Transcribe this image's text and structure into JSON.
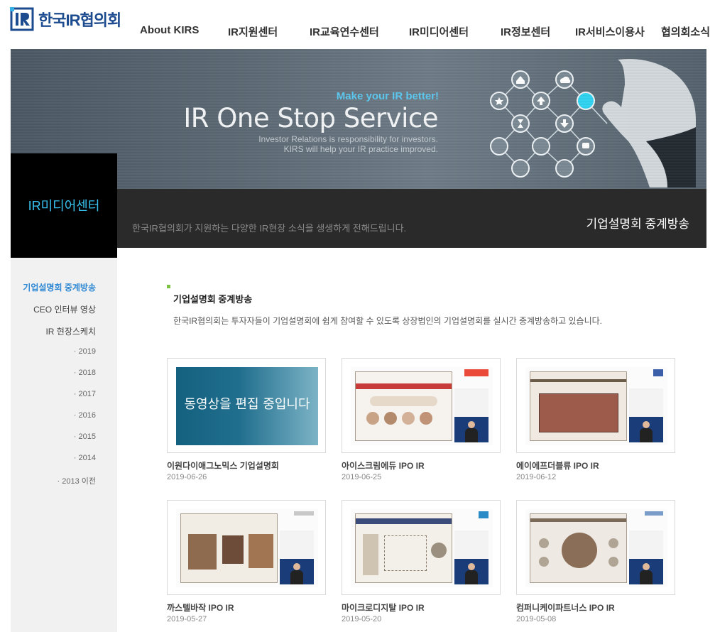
{
  "brand": {
    "logo_mark": "IR",
    "name": "한국IR협의회",
    "color": "#1d4b8f"
  },
  "nav": [
    {
      "label": "About KIRS"
    },
    {
      "label": "IR지원센터"
    },
    {
      "label": "IR교육연수센터"
    },
    {
      "label": "IR미디어센터"
    },
    {
      "label": "IR정보센터"
    },
    {
      "label": "IR서비스이용사"
    },
    {
      "label": "협의회소식"
    }
  ],
  "hero": {
    "tagline": "Make your IR better!",
    "title": "IR One Stop Service",
    "subtitle_line1": "Investor Relations is responsibility for investors.",
    "subtitle_line2": "KIRS will help your IR practice improved.",
    "accent_color": "#5bc8f0"
  },
  "section": {
    "name": "IR미디어센터",
    "band_desc": "한국IR협의회가 지원하는 다양한 IR현장 소식을 생생하게 전해드립니다.",
    "band_title": "기업설명회 중계방송"
  },
  "sidebar": {
    "items": [
      {
        "label": "기업설명회 중계방송",
        "active": true
      },
      {
        "label": "CEO 인터뷰 영상",
        "active": false
      },
      {
        "label": "IR 현장스케치",
        "active": false
      }
    ],
    "years": [
      "· 2019",
      "· 2018",
      "· 2017",
      "· 2016",
      "· 2015",
      "· 2014",
      "· 2013 이전"
    ],
    "active_color": "#2f88d4"
  },
  "content": {
    "title": "기업설명회 중계방송",
    "description": "한국IR협의회는 투자자들이 기업설명회에 쉽게 참여할 수 있도록 상장법인의 기업설명회를 실시간 중계방송하고 있습니다."
  },
  "cards": [
    {
      "title": "이원다이애그노믹스 기업설명회",
      "date": "2019-06-26",
      "editing_text": "동영상을 편집 중입니다"
    },
    {
      "title": "아이스크림에듀 IPO IR",
      "date": "2019-06-25"
    },
    {
      "title": "에이에프더블류 IPO IR",
      "date": "2019-06-12"
    },
    {
      "title": "까스텔바작 IPO IR",
      "date": "2019-05-27"
    },
    {
      "title": "마이크로디지탈 IPO IR",
      "date": "2019-05-20"
    },
    {
      "title": "컴퍼니케이파트너스 IPO IR",
      "date": "2019-05-08"
    }
  ]
}
